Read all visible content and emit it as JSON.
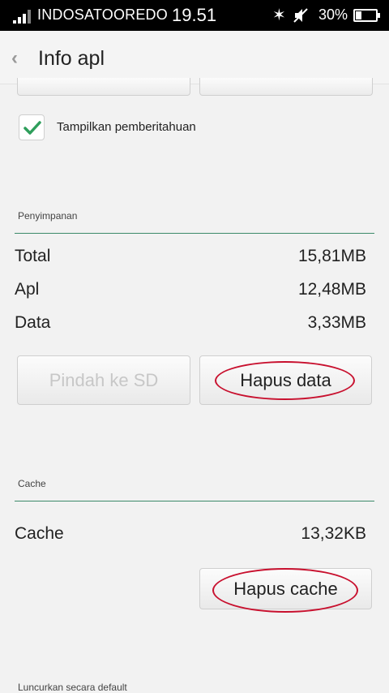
{
  "status_bar": {
    "carrier": "INDOSATOOREDO",
    "time": "19.51",
    "battery_percent": "30%",
    "battery_level": 0.3,
    "icons": [
      "signal-icon",
      "bluetooth-icon",
      "mute-icon",
      "battery-icon"
    ]
  },
  "header": {
    "back_icon": "‹",
    "title": "Info apl"
  },
  "notifications": {
    "checkbox_label": "Tampilkan pemberitahuan",
    "checked": true
  },
  "storage": {
    "section_label": "Penyimpanan",
    "rows": [
      {
        "label": "Total",
        "value": "15,81MB"
      },
      {
        "label": "Apl",
        "value": "12,48MB"
      },
      {
        "label": "Data",
        "value": "3,33MB"
      }
    ],
    "move_sd_label": "Pindah ke SD",
    "clear_data_label": "Hapus data"
  },
  "cache": {
    "section_label": "Cache",
    "label": "Cache",
    "value": "13,32KB",
    "clear_cache_label": "Hapus cache"
  },
  "launch_default": {
    "section_label": "Luncurkan secara default"
  },
  "colors": {
    "accent": "#3c8a6a",
    "check": "#2e9e5b",
    "annotation": "#c8102e"
  }
}
